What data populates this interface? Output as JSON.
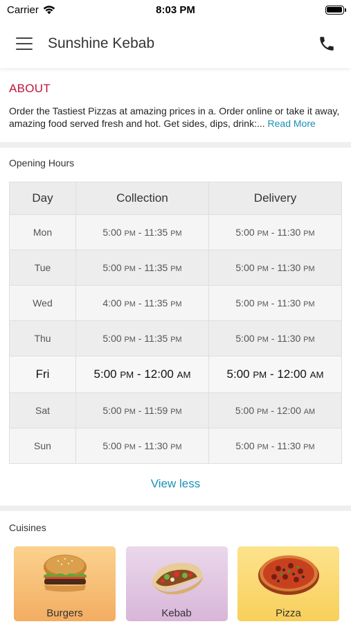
{
  "status_bar": {
    "carrier": "Carrier",
    "time": "8:03 PM",
    "wifi_icon": "wifi-icon",
    "battery_icon": "battery-icon"
  },
  "header": {
    "menu_icon": "hamburger-menu-icon",
    "title": "Sunshine Kebab",
    "phone_icon": "phone-icon"
  },
  "about": {
    "title": "ABOUT",
    "text": "Order the Tastiest Pizzas at amazing prices in a. Order online or take it away, amazing food served fresh and hot. Get sides, dips, drink:...",
    "read_more": "Read More"
  },
  "opening_hours": {
    "label": "Opening Hours",
    "headers": [
      "Day",
      "Collection",
      "Delivery"
    ],
    "rows": [
      {
        "day": "Mon",
        "collection": [
          "5:00",
          "PM",
          "11:35",
          "PM"
        ],
        "delivery": [
          "5:00",
          "PM",
          "11:30",
          "PM"
        ],
        "today": false
      },
      {
        "day": "Tue",
        "collection": [
          "5:00",
          "PM",
          "11:35",
          "PM"
        ],
        "delivery": [
          "5:00",
          "PM",
          "11:30",
          "PM"
        ],
        "today": false
      },
      {
        "day": "Wed",
        "collection": [
          "4:00",
          "PM",
          "11:35",
          "PM"
        ],
        "delivery": [
          "5:00",
          "PM",
          "11:30",
          "PM"
        ],
        "today": false
      },
      {
        "day": "Thu",
        "collection": [
          "5:00",
          "PM",
          "11:35",
          "PM"
        ],
        "delivery": [
          "5:00",
          "PM",
          "11:30",
          "PM"
        ],
        "today": false
      },
      {
        "day": "Fri",
        "collection": [
          "5:00",
          "PM",
          "12:00",
          "AM"
        ],
        "delivery": [
          "5:00",
          "PM",
          "12:00",
          "AM"
        ],
        "today": true
      },
      {
        "day": "Sat",
        "collection": [
          "5:00",
          "PM",
          "11:59",
          "PM"
        ],
        "delivery": [
          "5:00",
          "PM",
          "12:00",
          "AM"
        ],
        "today": false
      },
      {
        "day": "Sun",
        "collection": [
          "5:00",
          "PM",
          "11:30",
          "PM"
        ],
        "delivery": [
          "5:00",
          "PM",
          "11:30",
          "PM"
        ],
        "today": false
      }
    ],
    "view_less": "View less"
  },
  "cuisines": {
    "label": "Cuisines",
    "items": [
      {
        "name": "Burgers",
        "icon": "burger-icon"
      },
      {
        "name": "Kebab",
        "icon": "kebab-icon"
      },
      {
        "name": "Pizza",
        "icon": "pizza-icon"
      }
    ]
  },
  "colors": {
    "about_title": "#c0143c",
    "link": "#1b8fb8"
  }
}
